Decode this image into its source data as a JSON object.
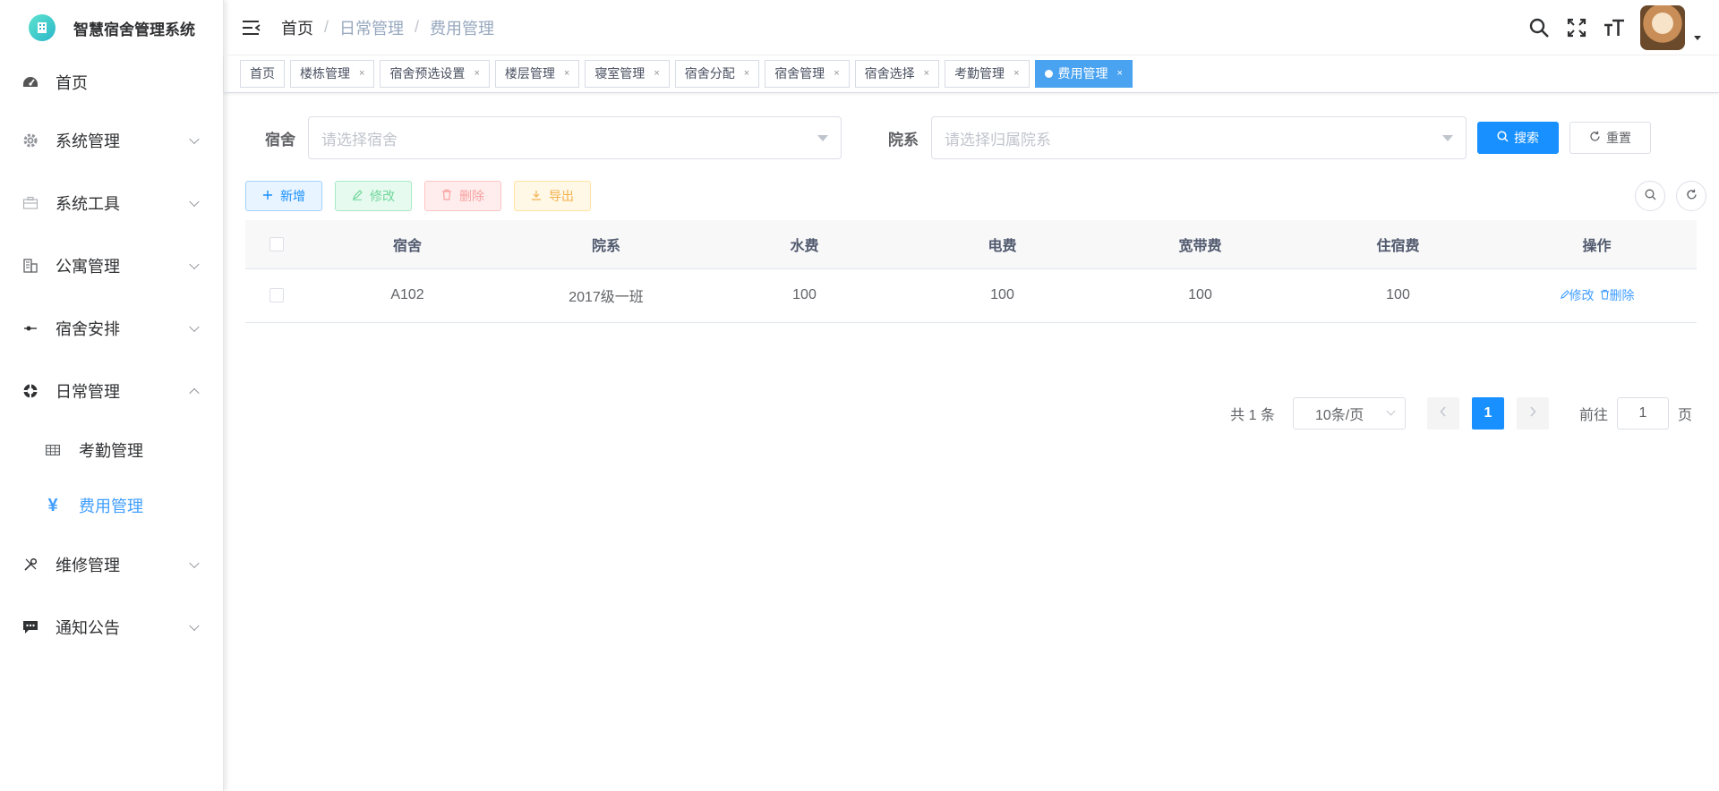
{
  "app": {
    "title": "智慧宿舍管理系统"
  },
  "sidebar": {
    "items": [
      {
        "label": "首页",
        "icon": "dashboard-icon"
      },
      {
        "label": "系统管理",
        "icon": "gear-icon"
      },
      {
        "label": "系统工具",
        "icon": "toolbox-icon"
      },
      {
        "label": "公寓管理",
        "icon": "building-icon"
      },
      {
        "label": "宿舍安排",
        "icon": "switch-icon"
      },
      {
        "label": "日常管理",
        "icon": "lifebuoy-icon"
      },
      {
        "label": "维修管理",
        "icon": "tools-icon"
      },
      {
        "label": "通知公告",
        "icon": "message-icon"
      }
    ],
    "sub_items": [
      {
        "label": "考勤管理",
        "icon": "table-icon"
      },
      {
        "label": "费用管理",
        "icon": "yen-icon"
      }
    ],
    "yen_glyph": "¥"
  },
  "breadcrumb": [
    "首页",
    "日常管理",
    "费用管理"
  ],
  "breadcrumb_sep": "/",
  "tags": [
    {
      "label": "首页"
    },
    {
      "label": "楼栋管理"
    },
    {
      "label": "宿舍预选设置"
    },
    {
      "label": "楼层管理"
    },
    {
      "label": "寝室管理"
    },
    {
      "label": "宿舍分配"
    },
    {
      "label": "宿舍管理"
    },
    {
      "label": "宿舍选择"
    },
    {
      "label": "考勤管理"
    },
    {
      "label": "费用管理"
    }
  ],
  "tag_close": "×",
  "search": {
    "dorm_label": "宿舍",
    "dorm_placeholder": "请选择宿舍",
    "dept_label": "院系",
    "dept_placeholder": "请选择归属院系",
    "search_button": "搜索",
    "reset_button": "重置"
  },
  "toolbar": {
    "add": "新增",
    "edit": "修改",
    "delete": "删除",
    "export": "导出"
  },
  "table": {
    "columns": [
      "宿舍",
      "院系",
      "水费",
      "电费",
      "宽带费",
      "住宿费",
      "操作"
    ],
    "rows": [
      {
        "dorm": "A102",
        "dept": "2017级一班",
        "water": "100",
        "electric": "100",
        "broadband": "100",
        "lodging": "100"
      }
    ],
    "row_edit": "修改",
    "row_delete": "删除"
  },
  "pagination": {
    "total": "共 1 条",
    "page_size": "10条/页",
    "current_page": "1",
    "goto_label": "前往",
    "goto_value": "1",
    "goto_suffix": "页"
  },
  "colors": {
    "primary": "#1890ff",
    "active_tag": "#4aa3f0",
    "active_menu": "#409eff"
  }
}
